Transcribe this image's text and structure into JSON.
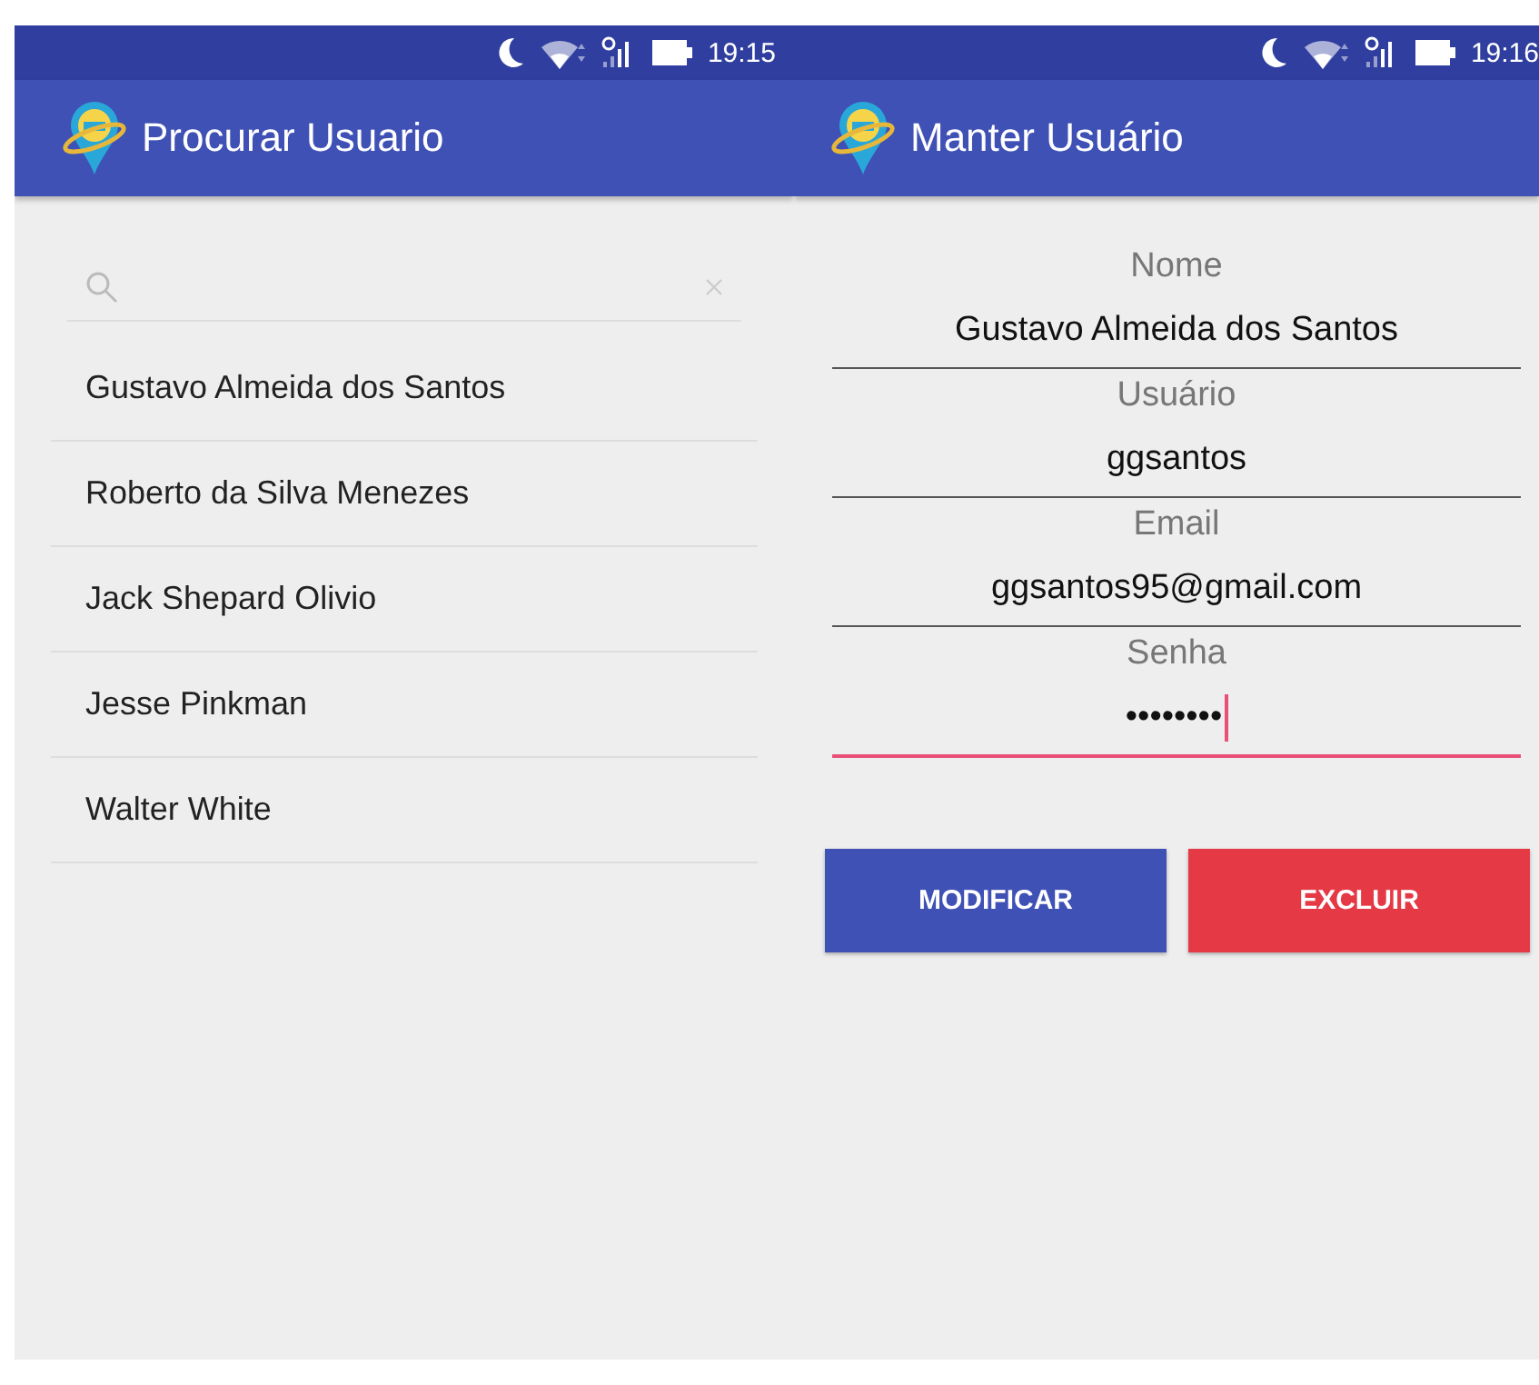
{
  "screens": [
    {
      "status_bar": {
        "time": "19:15"
      },
      "app_bar": {
        "title": "Procurar Usuario"
      },
      "kind": "search",
      "items": [
        {
          "label": "Gustavo Almeida dos Santos"
        },
        {
          "label": "Roberto da Silva Menezes"
        },
        {
          "label": "Jack Shepard Olivio"
        },
        {
          "label": "Jesse Pinkman"
        },
        {
          "label": "Walter White"
        }
      ]
    },
    {
      "status_bar": {
        "time": "19:16"
      },
      "app_bar": {
        "title": "Manter Usuário"
      },
      "kind": "form",
      "fields": [
        {
          "label": "Nome",
          "value": "Gustavo Almeida dos Santos",
          "focused": false
        },
        {
          "label": "Usuário",
          "value": "ggsantos",
          "focused": false
        },
        {
          "label": "Email",
          "value": "ggsantos95@gmail.com",
          "focused": false
        },
        {
          "label": "Senha",
          "value": "••••••••",
          "focused": true
        }
      ],
      "buttons": [
        {
          "label": "MODIFICAR",
          "kind": "primary"
        },
        {
          "label": "EXCLUIR",
          "kind": "danger"
        }
      ]
    }
  ]
}
